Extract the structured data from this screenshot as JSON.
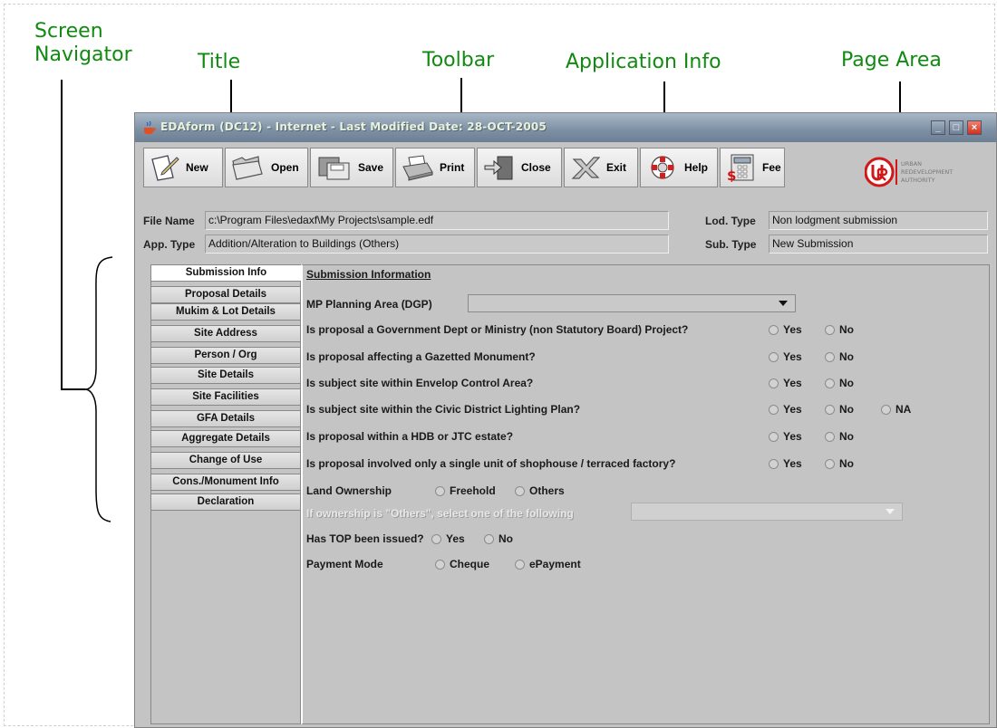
{
  "annotations": {
    "screen_navigator": "Screen\nNavigator",
    "screen_navigator_l1": "Screen",
    "screen_navigator_l2": "Navigator",
    "title": "Title",
    "toolbar": "Toolbar",
    "application_info": "Application Info",
    "page_area": "Page Area"
  },
  "window": {
    "title": "EDAform (DC12) - Internet - Last Modified Date: 28-OCT-2005",
    "buttons": {
      "minimize": "_",
      "maximize": "□",
      "close": "×"
    }
  },
  "toolbar": {
    "new": "New",
    "open": "Open",
    "save": "Save",
    "print": "Print",
    "close": "Close",
    "exit": "Exit",
    "help": "Help",
    "fee": "Fee"
  },
  "logo": {
    "line1": "URBAN",
    "line2": "REDEVELOPMENT",
    "line3": "AUTHORITY"
  },
  "app_info": {
    "file_name_label": "File Name",
    "file_name_value": "c:\\Program Files\\edaxf\\My Projects\\sample.edf",
    "app_type_label": "App. Type",
    "app_type_value": "Addition/Alteration to Buildings (Others)",
    "lod_type_label": "Lod. Type",
    "lod_type_value": "Non lodgment submission",
    "sub_type_label": "Sub. Type",
    "sub_type_value": "New Submission"
  },
  "navigator": {
    "tabs": [
      "Submission Info",
      "Proposal Details",
      "Mukim & Lot Details",
      "Site Address",
      "Person / Org",
      "Site Details",
      "Site Facilities",
      "GFA Details",
      "Aggregate Details",
      "Change of Use",
      "Cons./Monument Info",
      "Declaration"
    ]
  },
  "page": {
    "heading": "Submission Information",
    "mp_planning_label": "MP Planning Area (DGP)",
    "q1": "Is proposal a Government Dept or Ministry (non Statutory Board) Project?",
    "q2": "Is proposal affecting a Gazetted Monument?",
    "q3": "Is subject site within Envelop Control Area?",
    "q4": "Is subject site within the Civic District Lighting Plan?",
    "q5": "Is proposal within a HDB or JTC estate?",
    "q6": "Is proposal involved only a single unit of shophouse / terraced factory?",
    "yes": "Yes",
    "no": "No",
    "na": "NA",
    "land_ownership_label": "Land Ownership",
    "freehold": "Freehold",
    "others": "Others",
    "ownership_others_label": "If ownership is \"Others\", select one of the following",
    "top_label": "Has TOP been issued?",
    "payment_label": "Payment Mode",
    "cheque": "Cheque",
    "epayment": "ePayment"
  }
}
